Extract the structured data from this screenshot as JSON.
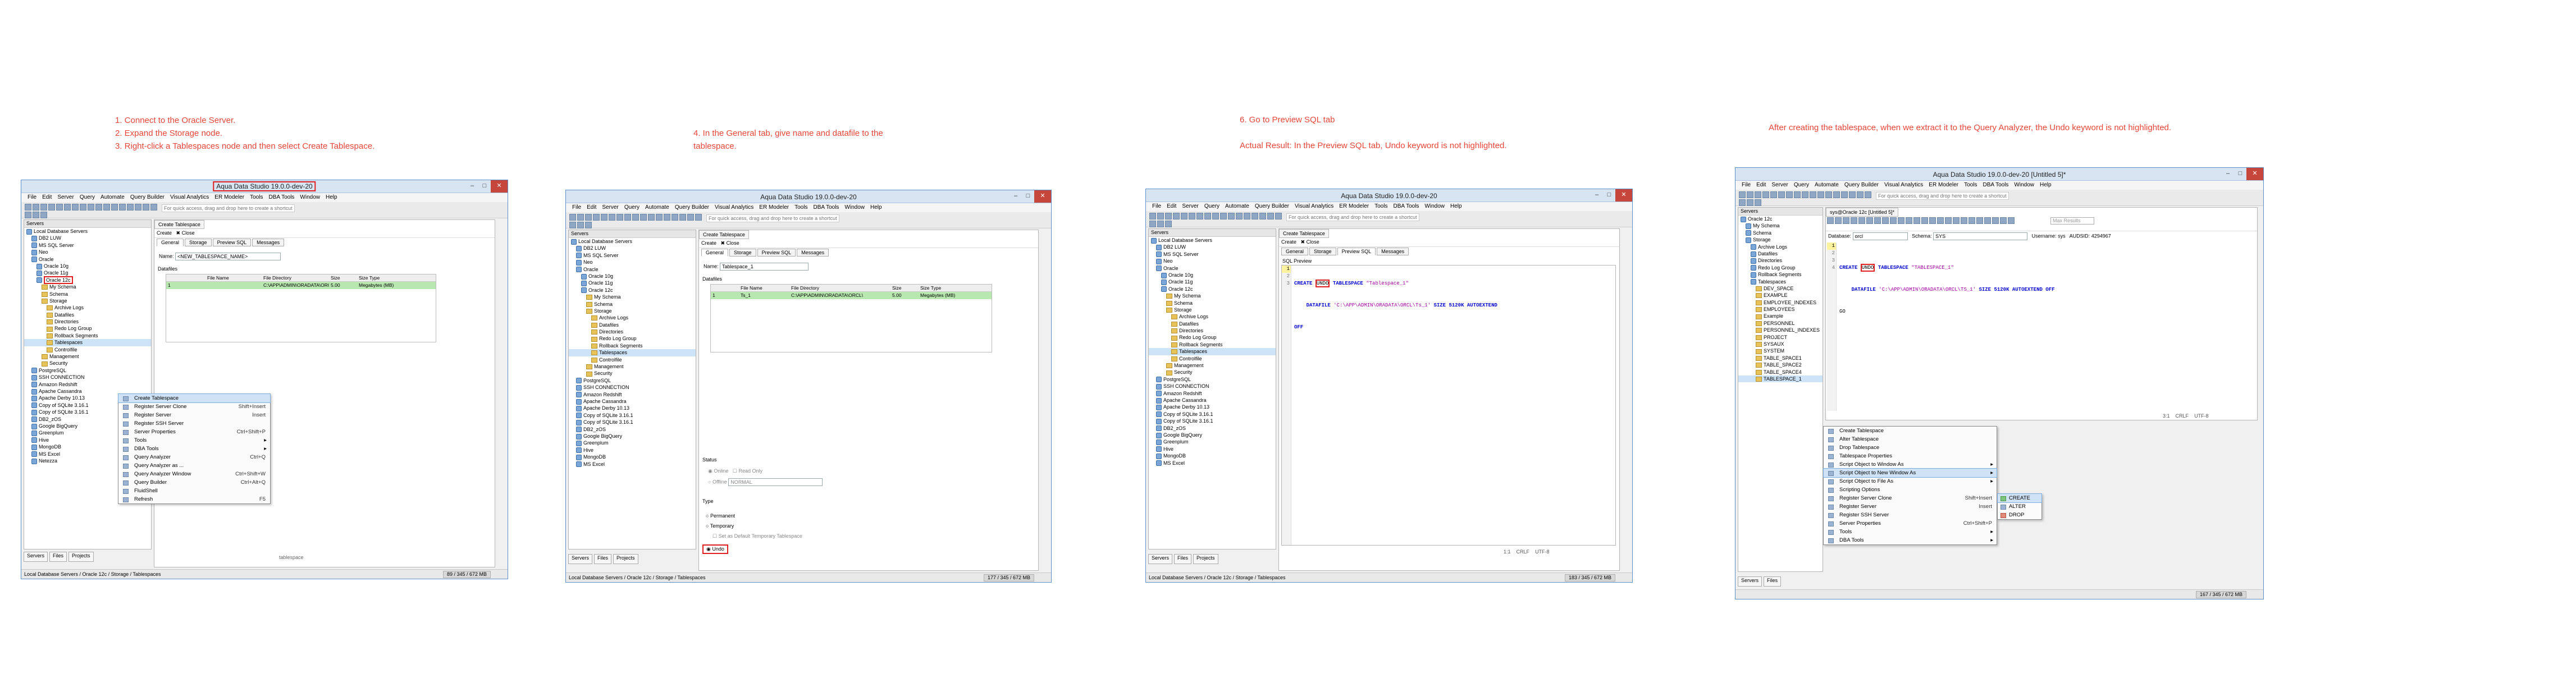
{
  "captions": {
    "step1": [
      "1. Connect to the Oracle Server.",
      "2. Expand the Storage node.",
      "3. Right-click a Tablespaces node and then select Create Tablespace."
    ],
    "step2": [
      "4. In the General tab, give name and datafile to the",
      "tablespace."
    ],
    "step3": [
      "6. Go to Preview SQL tab",
      "",
      "Actual Result: In the Preview SQL tab, Undo keyword is not highlighted."
    ],
    "step4": [
      "After creating the tablespace, when we extract it to the Query Analyzer, the Undo keyword is not highlighted."
    ]
  },
  "app": {
    "title": "Aqua Data Studio 19.0.0-dev-20",
    "title_untitled": "Aqua Data Studio 19.0.0-dev-20 [Untitled 5]*",
    "menu": [
      "File",
      "Edit",
      "Server",
      "Query",
      "Automate",
      "Query Builder",
      "Visual Analytics",
      "ER Modeler",
      "Tools",
      "DBA Tools",
      "Window",
      "Help"
    ],
    "toolbar_hint": "For quick access, drag and drop here to create a shortcut",
    "servers_label": "Servers",
    "bottom_tabs": [
      "Servers",
      "Files",
      "Projects"
    ],
    "status_path": "Local Database Servers / Oracle 12c / Storage / Tablespaces",
    "mem1": "89 / 345 / 672 MB",
    "mem2": "177 / 345 / 672 MB",
    "mem3": "183 / 345 / 672 MB",
    "mem4": "167 / 345 / 672 MB"
  },
  "tree1": [
    "Local Database Servers",
    "DB2 LUW",
    "MS SQL Server",
    "Neo",
    "Oracle",
    "Oracle 10g",
    "Oracle 11g",
    "Oracle 12c",
    "My Schema",
    "Schema",
    "Storage",
    "Archive Logs",
    "Datafiles",
    "Directories",
    "Redo Log Group",
    "Rollback Segments",
    "Tablespaces",
    "Controlfile",
    "Management",
    "Security",
    "PostgreSQL",
    "SSH CONNECTION",
    "Amazon Redshift",
    "Apache Cassandra",
    "Apache Derby 10.13",
    "Copy of SQLite 3.16.1",
    "Copy of SQLite 3.16.1",
    "DB2_zOS",
    "Google BigQuery",
    "Greenplum",
    "Hive",
    "MongoDB",
    "MS Excel",
    "Netezza"
  ],
  "tree2": [
    "Local Database Servers",
    "DB2 LUW",
    "MS SQL Server",
    "Neo",
    "Oracle",
    "Oracle 10g",
    "Oracle 11g",
    "Oracle 12c",
    "My Schema",
    "Schema",
    "Storage",
    "Archive Logs",
    "Datafiles",
    "Directories",
    "Redo Log Group",
    "Rollback Segments",
    "Tablespaces",
    "Controlfile",
    "Management",
    "Security",
    "PostgreSQL",
    "SSH CONNECTION",
    "Amazon Redshift",
    "Apache Cassandra",
    "Apache Derby 10.13",
    "Copy of SQLite 3.16.1",
    "Copy of SQLite 3.16.1",
    "DB2_zOS",
    "Google BigQuery",
    "Greenplum",
    "Hive",
    "MongoDB",
    "MS Excel"
  ],
  "tree4": [
    "Oracle 12c",
    "My Schema",
    "Schema",
    "Storage",
    "Archive Logs",
    "Datafiles",
    "Directories",
    "Redo Log Group",
    "Rollback Segments",
    "Tablespaces",
    "DEV_SPACE",
    "EXAMPLE",
    "EMPLOYEE_INDEXES",
    "EMPLOYEES",
    "Example",
    "PERSONNEL",
    "PERSONNEL_INDEXES",
    "PROJECT",
    "SYSAUX",
    "SYSTEM",
    "TABLE_SPACE1",
    "TABLE_SPACE2",
    "TABLE_SPACE4",
    "TABLESPACE_1"
  ],
  "context_menu1": [
    {
      "label": "Create Tablespace",
      "shortcut": ""
    },
    {
      "label": "Register Server Clone",
      "shortcut": "Shift+Insert"
    },
    {
      "label": "Register Server",
      "shortcut": "Insert"
    },
    {
      "label": "Register SSH Server",
      "shortcut": ""
    },
    {
      "label": "Server Properties",
      "shortcut": "Ctrl+Shift+P"
    },
    {
      "label": "Tools",
      "shortcut": ""
    },
    {
      "label": "DBA Tools",
      "shortcut": ""
    },
    {
      "label": "Query Analyzer",
      "shortcut": "Ctrl+Q"
    },
    {
      "label": "Query Analyzer as ...",
      "shortcut": ""
    },
    {
      "label": "Query Analyzer Window",
      "shortcut": "Ctrl+Shift+W"
    },
    {
      "label": "Query Builder",
      "shortcut": "Ctrl+Alt+Q"
    },
    {
      "label": "FluidShell",
      "shortcut": ""
    },
    {
      "label": "Refresh",
      "shortcut": "F5"
    }
  ],
  "context_menu4": [
    {
      "label": "Create Tablespace",
      "shortcut": ""
    },
    {
      "label": "Alter Tablespace",
      "shortcut": ""
    },
    {
      "label": "Drop Tablespace",
      "shortcut": ""
    },
    {
      "label": "Tablespace Properties",
      "shortcut": ""
    },
    {
      "label": "Script Object to Window As",
      "shortcut": ""
    },
    {
      "label": "Script Object to New Window As",
      "shortcut": ""
    },
    {
      "label": "Script Object to File As",
      "shortcut": ""
    },
    {
      "label": "Scripting Options",
      "shortcut": ""
    },
    {
      "label": "Register Server Clone",
      "shortcut": "Shift+Insert"
    },
    {
      "label": "Register Server",
      "shortcut": "Insert"
    },
    {
      "label": "Register SSH Server",
      "shortcut": ""
    },
    {
      "label": "Server Properties",
      "shortcut": "Ctrl+Shift+P"
    },
    {
      "label": "Tools",
      "shortcut": ""
    },
    {
      "label": "DBA Tools",
      "shortcut": ""
    }
  ],
  "submenu4": [
    "CREATE",
    "ALTER",
    "DROP"
  ],
  "create_ts": {
    "tab_label": "Create Tablespace",
    "create_btn": "Create",
    "close_btn": "Close",
    "subtabs": [
      "General",
      "Storage",
      "Preview SQL",
      "Messages"
    ],
    "name_label": "Name:",
    "name_value1": "<NEW_TABLESPACE_NAME>",
    "name_value2": "Tablespace_1",
    "datafiles_label": "Datafiles",
    "cols": [
      "File Name",
      "File Directory",
      "Size",
      "Size Type"
    ],
    "row1": [
      "1",
      "",
      "C:\\APP\\ADMIN\\ORADATA\\ORCL\\",
      "5.00",
      "Megabytes (MB)"
    ],
    "row2": [
      "1",
      "Ts_1",
      "C:\\APP\\ADMIN\\ORADATA\\ORCL\\",
      "5.00",
      "Megabytes (MB)"
    ],
    "status_label": "Status",
    "online": "Online",
    "read_only": "Read Only",
    "offline": "Offline",
    "normal": "NORMAL",
    "type_label": "Type",
    "permanent": "Permanent",
    "temporary": "Temporary",
    "set_default_temp": "Set as Default Temporary Tablespace",
    "undo": "Undo",
    "tablespace_hint": "tablespace"
  },
  "preview": {
    "label": "SQL Preview",
    "line1_kw1": "CREATE",
    "line1_undo": "UNDO",
    "line1_kw2": "TABLESPACE",
    "line1_str": "\"Tablespace_1\"",
    "line2_kw": "DATAFILE",
    "line2_str": "'C:\\APP\\ADMIN\\ORADATA\\ORCL\\Ts_1'",
    "line2_rest": "SIZE 5120K AUTOEXTEND",
    "line3": "OFF",
    "cursor_pos": "1:1",
    "encoding": "CRLF",
    "charset": "UTF-8"
  },
  "qa": {
    "tab": "sys@Oracle 12c [Untitled 5]*",
    "database_label": "Database:",
    "database_value": "orcl",
    "schema_label": "Schema:",
    "schema_value": "SYS",
    "username_label": "Username:",
    "username_value": "sys",
    "audsid_label": "AUDSID:",
    "audsid_value": "4294967",
    "results_placeholder": "Max Results",
    "line1_kw1": "CREATE",
    "line1_undo": "UNDO",
    "line1_kw2": "TABLESPACE",
    "line1_str": "\"TABLESPACE_1\"",
    "line2_kw": "DATAFILE",
    "line2_str": "'C:\\APP\\ADMIN\\ORADATA\\ORCL\\TS_1'",
    "line2_rest": "SIZE 5120K AUTOEXTEND OFF",
    "line3": "GO",
    "cursor_pos": "3:1",
    "encoding": "CRLF",
    "charset": "UTF-8"
  },
  "colors": {
    "caption": "#e8463a",
    "highlight_box": "#e02020",
    "keyword": "#0000d0",
    "string": "#a000a0",
    "grid_row": "#b8e8b0"
  }
}
